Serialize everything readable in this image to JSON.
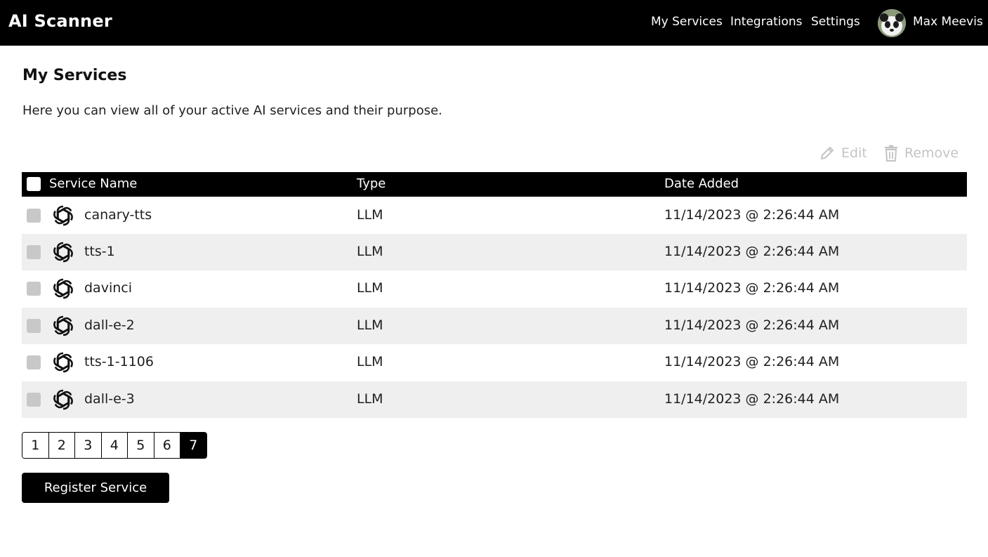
{
  "app": {
    "title": "AI Scanner"
  },
  "nav": {
    "links": [
      {
        "label": "My Services"
      },
      {
        "label": "Integrations"
      },
      {
        "label": "Settings"
      }
    ],
    "user": {
      "name": "Max Meevis",
      "avatar_icon": "panda-avatar"
    }
  },
  "page": {
    "title": "My Services",
    "description": "Here you can view all of your active AI services and their purpose."
  },
  "actions": {
    "edit_label": "Edit",
    "edit_icon": "pencil-icon",
    "remove_label": "Remove",
    "remove_icon": "trash-icon",
    "disabled_color": "#c4c4c4"
  },
  "table": {
    "columns": [
      "Service Name",
      "Type",
      "Date Added"
    ],
    "rows": [
      {
        "name": "canary-tts",
        "type": "LLM",
        "date": "11/14/2023 @ 2:26:44 AM",
        "icon": "openai-logo-icon"
      },
      {
        "name": "tts-1",
        "type": "LLM",
        "date": "11/14/2023 @ 2:26:44 AM",
        "icon": "openai-logo-icon"
      },
      {
        "name": "davinci",
        "type": "LLM",
        "date": "11/14/2023 @ 2:26:44 AM",
        "icon": "openai-logo-icon"
      },
      {
        "name": "dall-e-2",
        "type": "LLM",
        "date": "11/14/2023 @ 2:26:44 AM",
        "icon": "openai-logo-icon"
      },
      {
        "name": "tts-1-1106",
        "type": "LLM",
        "date": "11/14/2023 @ 2:26:44 AM",
        "icon": "openai-logo-icon"
      },
      {
        "name": "dall-e-3",
        "type": "LLM",
        "date": "11/14/2023 @ 2:26:44 AM",
        "icon": "openai-logo-icon"
      }
    ]
  },
  "pagination": {
    "pages": [
      "1",
      "2",
      "3",
      "4",
      "5",
      "6",
      "7"
    ],
    "current": "7"
  },
  "register": {
    "label": "Register Service"
  },
  "colors": {
    "header_bg": "#000000",
    "alt_row_bg": "#efefef",
    "accent": "#000000"
  }
}
